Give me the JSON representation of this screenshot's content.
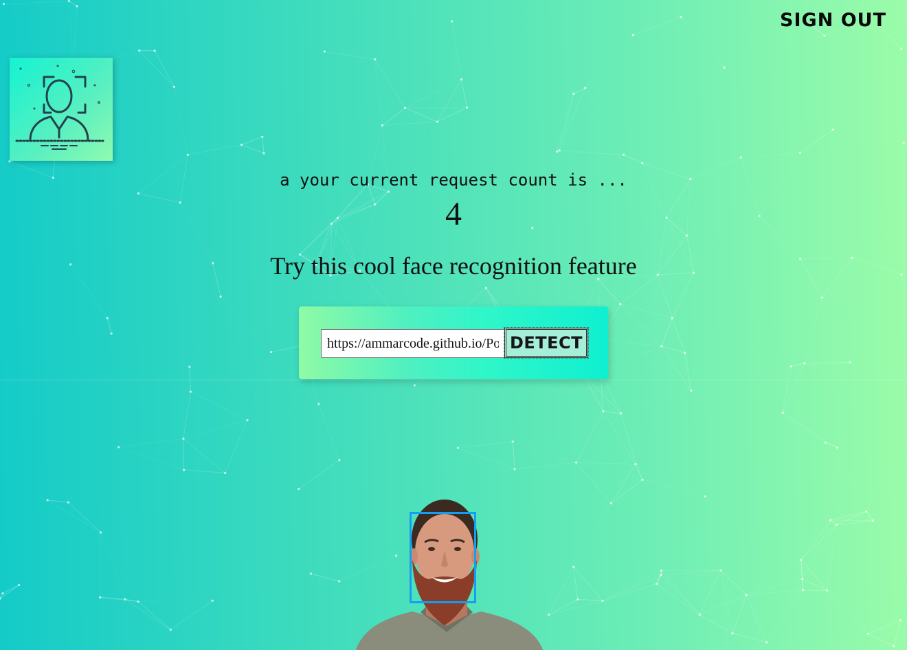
{
  "nav": {
    "signout_label": "SIGN OUT"
  },
  "logo": {
    "icon": "face-scan-icon"
  },
  "rank": {
    "message": "a your current request count is ...",
    "count": "4"
  },
  "headline": "Try this cool face recognition feature",
  "form": {
    "url_value": "https://ammarcode.github.io/Portfolio",
    "detect_label": "DETECT"
  },
  "result": {
    "image": "bearded-man-photo",
    "face_box_color": "#149df2",
    "faces_detected": 1
  },
  "colors": {
    "bg_start": "#14cbc8",
    "bg_end": "#9bfca9",
    "text": "#111111"
  }
}
